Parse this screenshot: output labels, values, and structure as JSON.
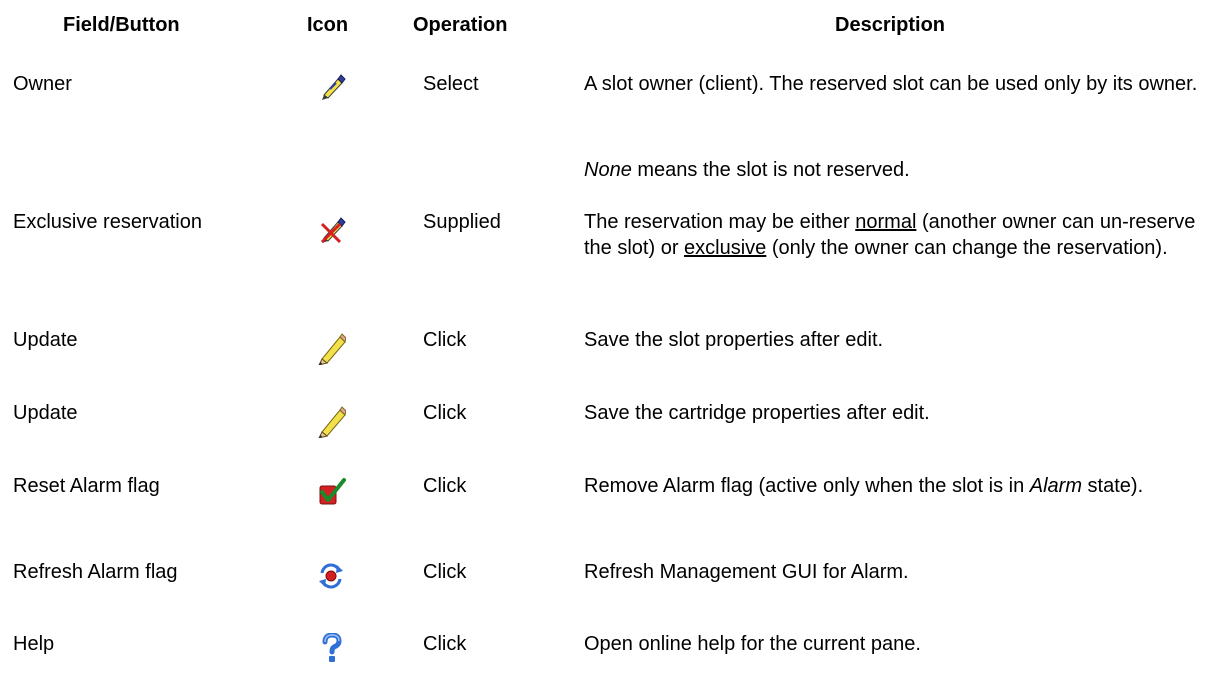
{
  "headers": {
    "field": "Field/Button",
    "icon": "Icon",
    "operation": "Operation",
    "description": "Description"
  },
  "rows": [
    {
      "field": "Owner",
      "icon": "pen-nib-icon",
      "operation": "Select",
      "description": "A slot owner (client). The reserved slot can be used only by its owner.",
      "note_italic": "None",
      "note_rest": " means the slot is not reserved."
    },
    {
      "field": "Exclusive reservation",
      "icon": "pen-crossed-icon",
      "operation": "Supplied",
      "desc_a": "The reservation may be either ",
      "desc_normal": "normal",
      "desc_b": " (another owner can un-reserve the slot) or ",
      "desc_exclusive": "exclusive",
      "desc_c": " (only the owner can change the reservation)."
    },
    {
      "field": "Update",
      "icon": "pencil-icon",
      "operation": "Click",
      "description": "Save the slot properties after edit."
    },
    {
      "field": "Update",
      "icon": "pencil-icon",
      "operation": "Click",
      "description": "Save the cartridge properties after edit."
    },
    {
      "field": "Reset Alarm flag",
      "icon": "checkmark-flag-icon",
      "operation": "Click",
      "desc_a": "Remove Alarm flag (active only when the slot is in ",
      "desc_alarm": "Alarm",
      "desc_b": " state)."
    },
    {
      "field": "Refresh Alarm flag",
      "icon": "refresh-arrows-icon",
      "operation": "Click",
      "description": "Refresh Management GUI for Alarm."
    },
    {
      "field": "Help",
      "icon": "question-mark-icon",
      "operation": "Click",
      "description": "Open online help for the current pane."
    }
  ],
  "colors": {
    "text": "#000000",
    "pencil_yellow": "#f3e14b",
    "pencil_blue": "#2a3f9e",
    "alert_red": "#d42020",
    "check_green": "#1a8a2a",
    "help_blue": "#2f6fd6"
  }
}
